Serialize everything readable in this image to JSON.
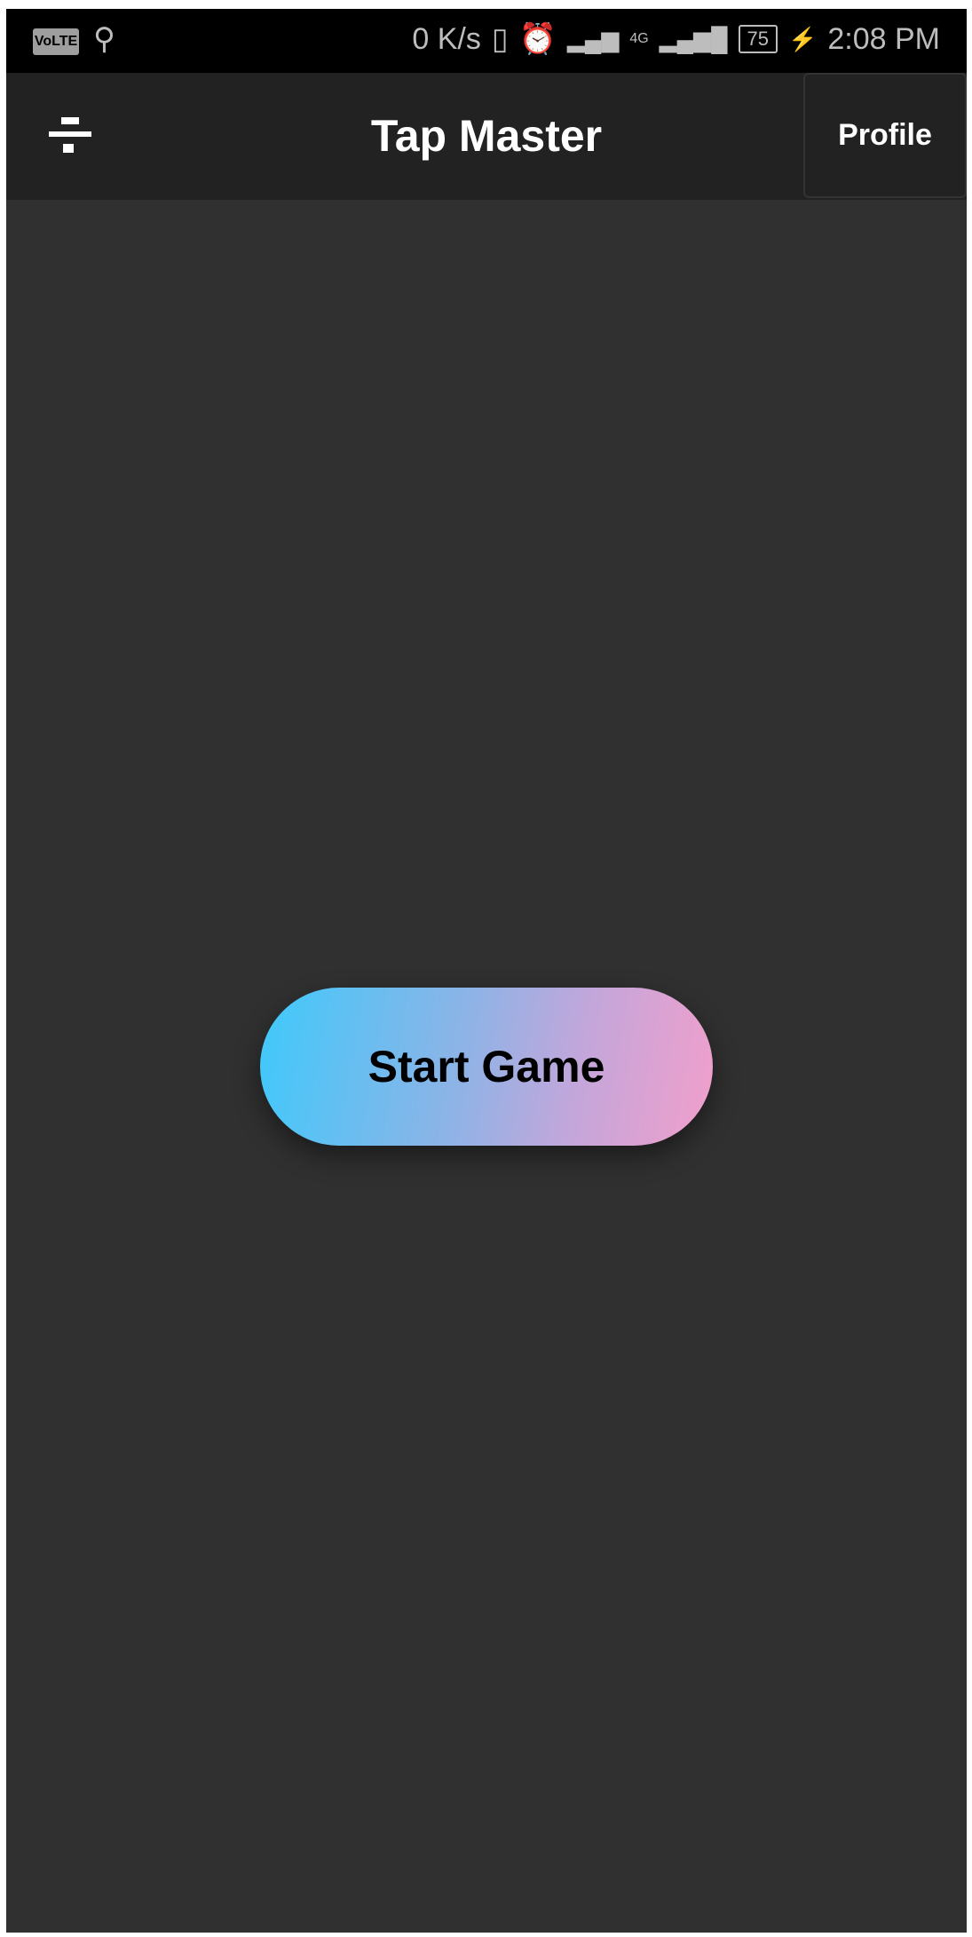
{
  "status_bar": {
    "volte": "VoLTE",
    "net_speed": "0 K/s",
    "network": "4G",
    "battery": "75",
    "time": "2:08 PM"
  },
  "app_bar": {
    "title": "Tap Master",
    "profile_label": "Profile"
  },
  "main": {
    "start_label": "Start Game"
  },
  "colors": {
    "gradient_start": "#3fc9fb",
    "gradient_end": "#f19fcb",
    "background": "#303030",
    "app_bar": "#222222"
  }
}
